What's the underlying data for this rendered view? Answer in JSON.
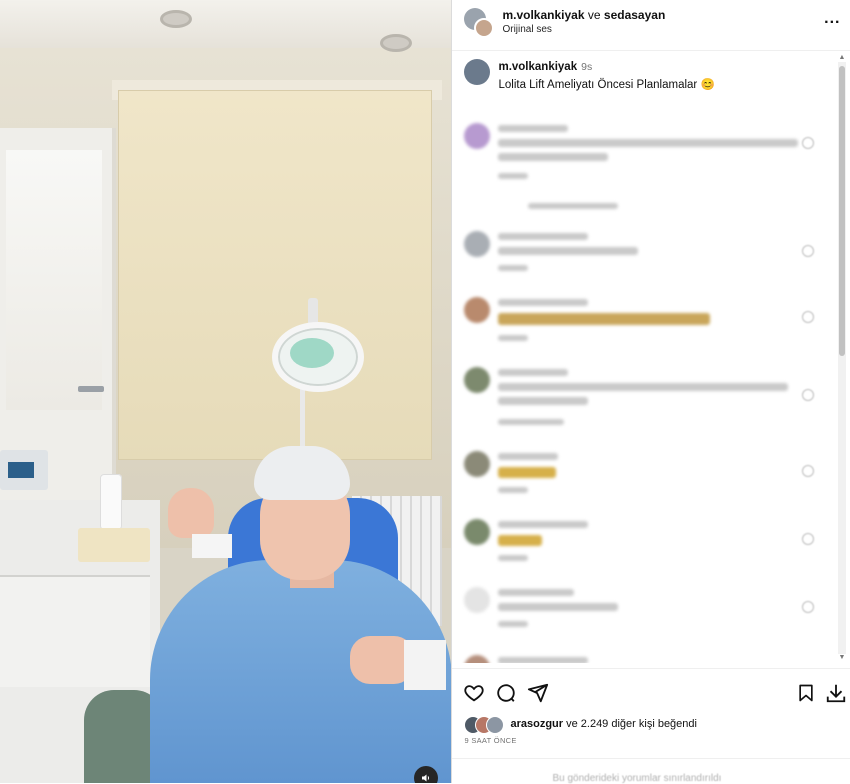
{
  "post": {
    "header_user": "m.volkankiyak",
    "header_connector": "ve",
    "header_collab": "sedasayan",
    "audio": "Orijinal ses",
    "more_label": "..."
  },
  "caption": {
    "username": "m.volkankiyak",
    "age": "9s",
    "text": "Lolita Lift Ameliyatı Öncesi Planlamalar 😊"
  },
  "likes": {
    "user": "arasozgur",
    "rest": " ve 2.249 diğer kişi beğendi"
  },
  "timestamp": "9 SAAT ÖNCE",
  "restricted_note": "Bu gönderideki yorumlar sınırlandırıldı",
  "colors": {
    "accent": "#0095f6",
    "text": "#262626",
    "muted": "#737373",
    "gown": "#6fa2d8"
  },
  "icons": [
    "heart-icon",
    "comment-icon",
    "share-icon",
    "bookmark-icon",
    "download-icon",
    "more-icon",
    "mute-icon"
  ]
}
